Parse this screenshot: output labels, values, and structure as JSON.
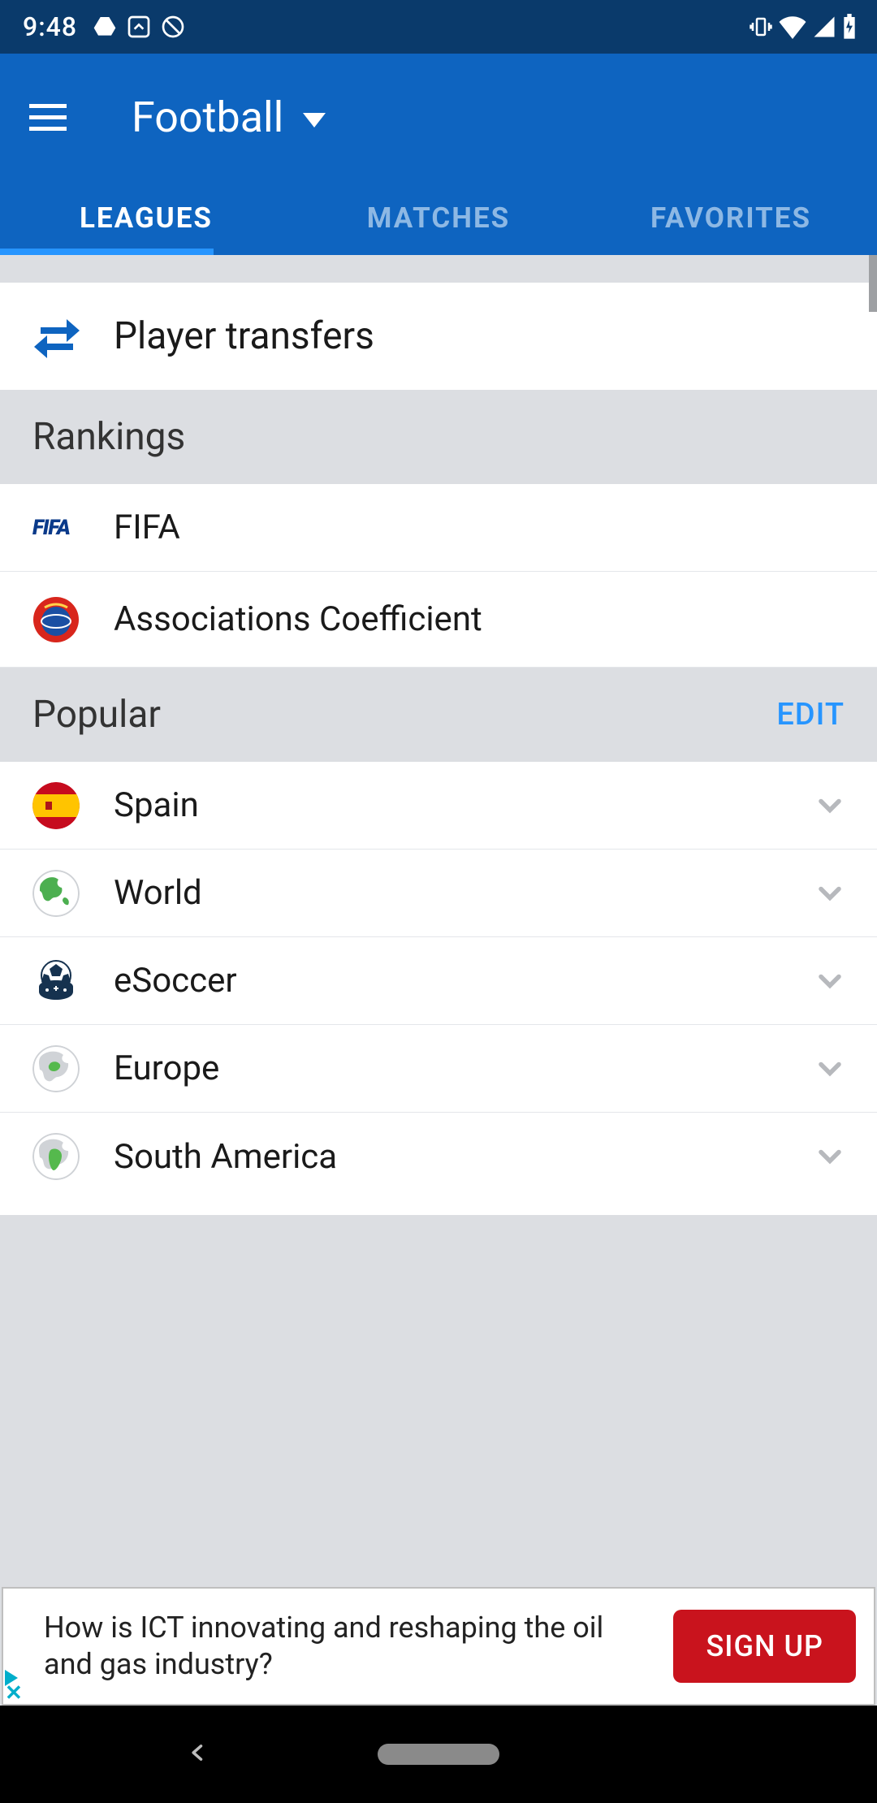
{
  "status": {
    "time": "9:48"
  },
  "header": {
    "title": "Football"
  },
  "tabs": [
    {
      "label": "LEAGUES",
      "active": true
    },
    {
      "label": "MATCHES",
      "active": false
    },
    {
      "label": "FAVORITES",
      "active": false
    }
  ],
  "transfers": {
    "label": "Player transfers"
  },
  "sections": {
    "rankings": {
      "title": "Rankings",
      "items": [
        {
          "label": "FIFA",
          "icon": "fifa"
        },
        {
          "label": "Associations Coefficient",
          "icon": "uefa"
        }
      ]
    },
    "popular": {
      "title": "Popular",
      "action": "EDIT",
      "items": [
        {
          "label": "Spain",
          "icon": "flag-spain"
        },
        {
          "label": "World",
          "icon": "globe-green"
        },
        {
          "label": "eSoccer",
          "icon": "esoccer"
        },
        {
          "label": "Europe",
          "icon": "globe-europe"
        },
        {
          "label": "South America",
          "icon": "globe-sa"
        }
      ]
    }
  },
  "ad": {
    "text": "How is ICT innovating and reshaping the oil and gas industry?",
    "cta": "SIGN UP"
  }
}
